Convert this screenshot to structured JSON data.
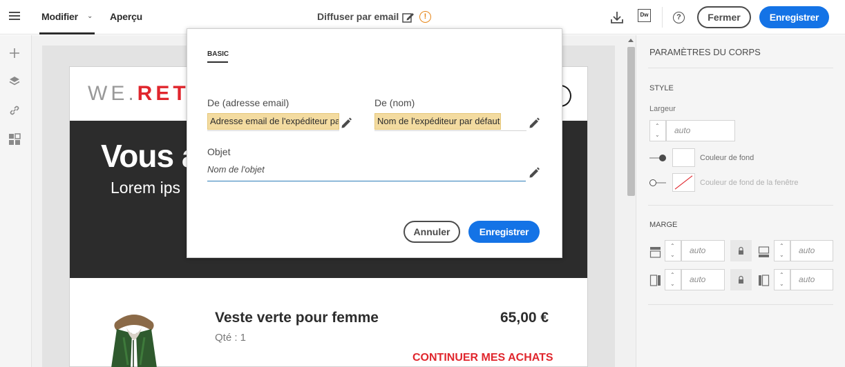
{
  "header": {
    "tabs": [
      {
        "label": "Modifier",
        "active": true
      },
      {
        "label": "Aperçu",
        "active": false
      }
    ],
    "title": "Diffuser par email",
    "warning_symbol": "!",
    "dw_label": "Dw",
    "help_symbol": "?",
    "close_label": "Fermer",
    "save_label": "Enregistrer"
  },
  "left_rail": {
    "icons": [
      "plus-icon",
      "layers-icon",
      "link-icon",
      "components-icon"
    ]
  },
  "email_preview": {
    "logo_light": "WE.",
    "logo_bold": "RET",
    "hero_title": "Vous a",
    "hero_subtitle": "Lorem ips",
    "product_name": "Veste verte pour femme",
    "product_price": "65,00 €",
    "product_qty": "Qté : 1",
    "product_cta": "CONTINUER MES ACHATS"
  },
  "right_panel": {
    "title": "PARAMÈTRES DU CORPS",
    "style": {
      "section": "STYLE",
      "width_label": "Largeur",
      "width_value": "auto",
      "bg_color_label": "Couleur de fond",
      "window_bg_color_label": "Couleur de fond de la fenêtre"
    },
    "margin": {
      "section": "MARGE",
      "top": "auto",
      "bottom": "auto",
      "left": "auto",
      "right": "auto"
    }
  },
  "dialog": {
    "tab": "BASIC",
    "from_email_label": "De (adresse email)",
    "from_email_value": "Adresse email de l'expéditeur par défaut",
    "from_name_label": "De (nom)",
    "from_name_value": "Nom de l'expéditeur par défaut",
    "subject_label": "Objet",
    "subject_placeholder": "Nom de l'objet",
    "cancel_label": "Annuler",
    "save_label": "Enregistrer"
  },
  "colors": {
    "accent": "#1473e6",
    "warning": "#e68619",
    "brand_red": "#e0262d",
    "field_highlight": "#f3dba0"
  }
}
